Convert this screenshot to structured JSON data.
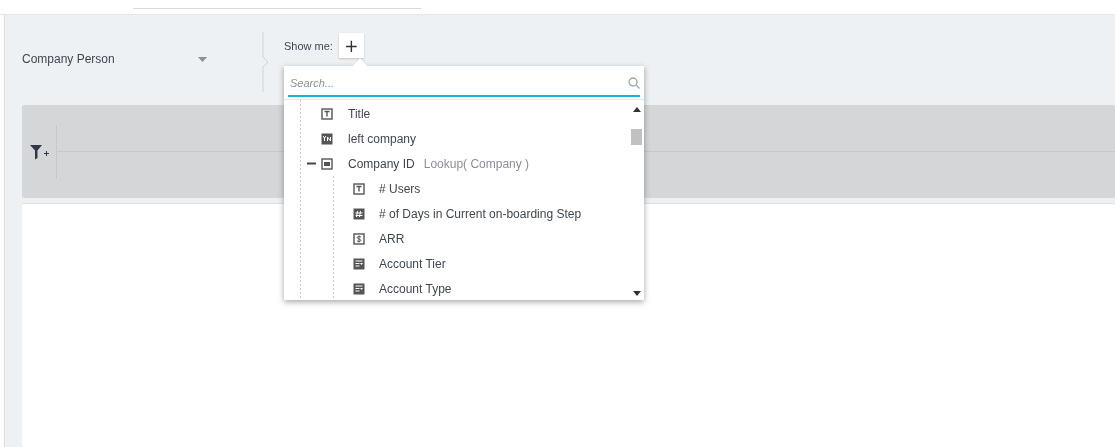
{
  "entity_select": {
    "value": "Company Person"
  },
  "show_me": {
    "label": "Show me:",
    "add_button": "+"
  },
  "field_picker": {
    "search": {
      "placeholder": "Search..."
    },
    "tree": [
      {
        "label": "Title",
        "kind": "text"
      },
      {
        "label": "left company",
        "kind": "yesno"
      },
      {
        "label": "Company ID",
        "kind": "id",
        "type_hint": "Lookup( Company )",
        "expanded": true,
        "children": [
          {
            "label": "# Users",
            "kind": "text"
          },
          {
            "label": "# of Days in Current on-boarding Step",
            "kind": "number"
          },
          {
            "label": "ARR",
            "kind": "currency"
          },
          {
            "label": "Account Tier",
            "kind": "picklist"
          },
          {
            "label": "Account Type",
            "kind": "picklist"
          }
        ]
      }
    ]
  }
}
